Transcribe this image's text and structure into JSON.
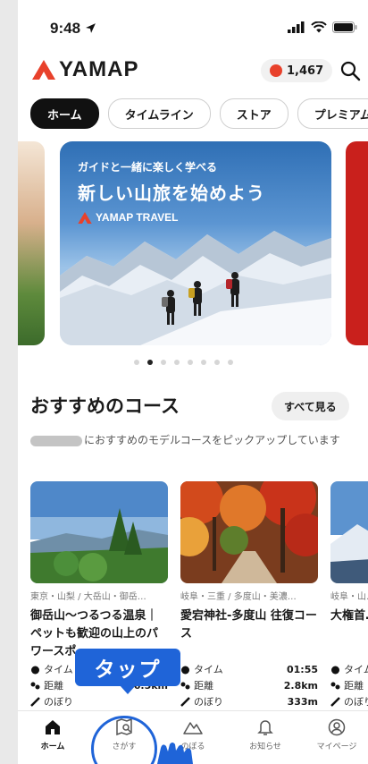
{
  "status_bar": {
    "time": "9:48"
  },
  "header": {
    "logo_text": "YAMAP",
    "points": "1,467"
  },
  "tabs": [
    {
      "label": "ホーム",
      "active": true
    },
    {
      "label": "タイムライン",
      "active": false
    },
    {
      "label": "ストア",
      "active": false
    },
    {
      "label": "プレミアム",
      "active": false
    }
  ],
  "banner": {
    "subtitle": "ガイドと一緒に楽しく学べる",
    "title": "新しい山旅を始めよう",
    "brand": "YAMAP TRAVEL",
    "page_count": 8,
    "active_index": 1
  },
  "section": {
    "title": "おすすめのコース",
    "see_all": "すべて見る",
    "description": "におすすめのモデルコースをピックアップしています"
  },
  "courses": [
    {
      "location": "東京・山梨 / 大岳山・御岳…",
      "title": "御岳山〜つるつる温泉｜ペットも歓迎の山上のパワースポ",
      "stats": [
        {
          "label": "タイム",
          "value": ""
        },
        {
          "label": "距離",
          "value": "6.5km"
        },
        {
          "label": "のぼり",
          "value": ""
        }
      ]
    },
    {
      "location": "岐阜・三重 / 多度山・美濃…",
      "title": "愛宕神社-多度山 往復コース",
      "stats": [
        {
          "label": "タイム",
          "value": "01:55"
        },
        {
          "label": "距離",
          "value": "2.8km"
        },
        {
          "label": "のぼり",
          "value": "333m"
        }
      ]
    },
    {
      "location": "岐阜・山…",
      "title": "大権首…ース",
      "stats": [
        {
          "label": "タイム",
          "value": ""
        },
        {
          "label": "距離",
          "value": ""
        },
        {
          "label": "のぼり",
          "value": ""
        }
      ]
    }
  ],
  "bottom_nav": [
    {
      "label": "ホーム",
      "icon": "home-icon",
      "active": true
    },
    {
      "label": "さがす",
      "icon": "map-search-icon",
      "active": false
    },
    {
      "label": "のぼる",
      "icon": "mountain-icon",
      "active": false
    },
    {
      "label": "お知らせ",
      "icon": "bell-icon",
      "active": false
    },
    {
      "label": "マイページ",
      "icon": "user-icon",
      "active": false
    }
  ],
  "annotation": {
    "callout": "タップ"
  },
  "colors": {
    "brand_red": "#e8412b",
    "callout_blue": "#1f64d8"
  }
}
